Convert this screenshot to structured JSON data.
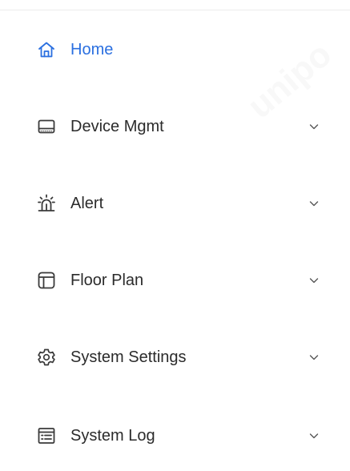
{
  "colors": {
    "accent": "#2a6fe0",
    "text": "#2b2b2b",
    "icon": "#3a3a3a",
    "divider": "#ececec"
  },
  "watermark": "unipo",
  "menu": {
    "items": [
      {
        "label": "Home",
        "icon": "home-icon",
        "active": true,
        "expandable": false
      },
      {
        "label": "Device Mgmt",
        "icon": "device-icon",
        "active": false,
        "expandable": true
      },
      {
        "label": "Alert",
        "icon": "alarm-light-icon",
        "active": false,
        "expandable": true
      },
      {
        "label": "Floor Plan",
        "icon": "floor-plan-icon",
        "active": false,
        "expandable": true
      },
      {
        "label": "System Settings",
        "icon": "gear-icon",
        "active": false,
        "expandable": true
      },
      {
        "label": "System Log",
        "icon": "log-icon",
        "active": false,
        "expandable": true
      }
    ]
  }
}
